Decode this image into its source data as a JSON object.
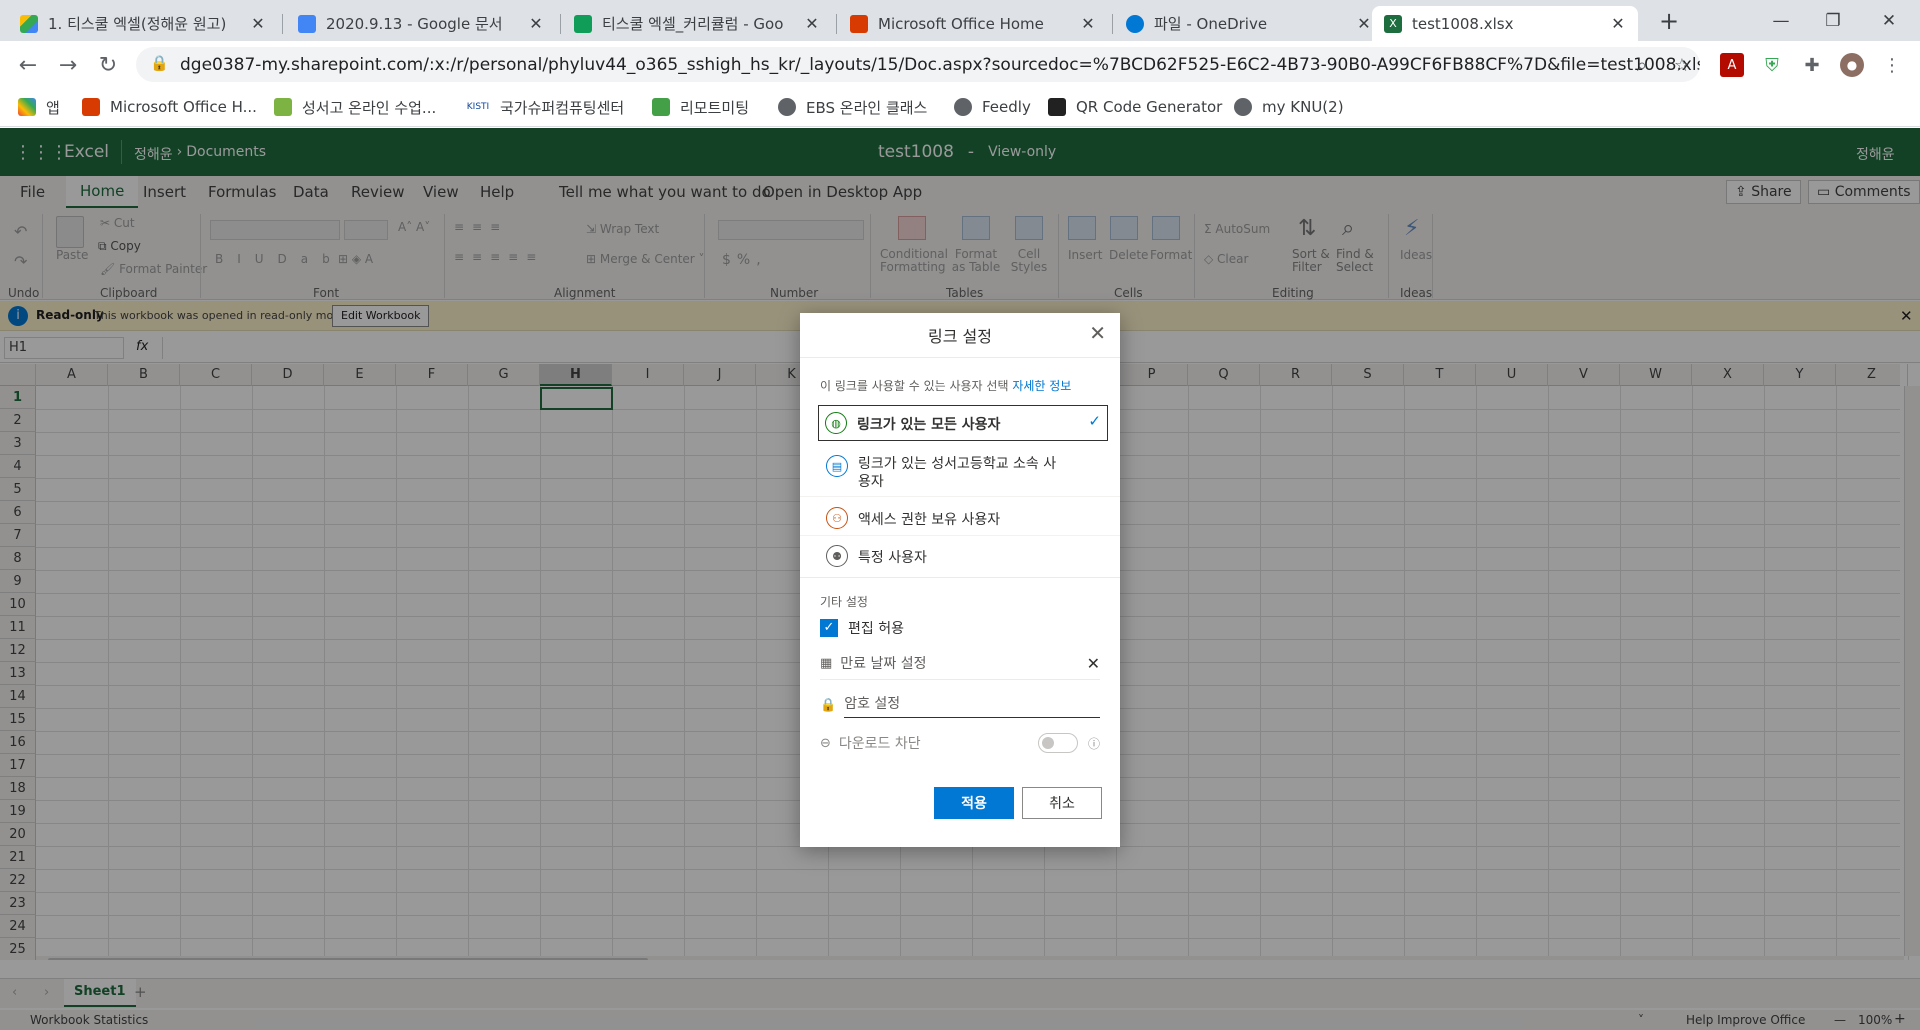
{
  "browser": {
    "tabs": [
      {
        "title": "1. 티스쿨 엑셀(정해윤 원고)",
        "icon": "google-drive-icon"
      },
      {
        "title": "2020.9.13 - Google 문서",
        "icon": "google-docs-icon"
      },
      {
        "title": "티스쿨 엑셀_커리큘럼 - Goo",
        "icon": "google-sheets-icon"
      },
      {
        "title": "Microsoft Office Home",
        "icon": "office-icon"
      },
      {
        "title": "파일 - OneDrive",
        "icon": "onedrive-icon"
      },
      {
        "title": "test1008.xlsx",
        "icon": "excel-icon"
      }
    ],
    "url": "dge0387-my.sharepoint.com/:x:/r/personal/phyluv44_o365_sshigh_hs_kr/_layouts/15/Doc.aspx?sourcedoc=%7BCD62F525-E6C2-4B73-90B0-A99CF6FB88CF%7D&file=test1008.xlsx&...",
    "bookmarks": [
      {
        "label": "앱"
      },
      {
        "label": "Microsoft Office H..."
      },
      {
        "label": "성서고 온라인 수업..."
      },
      {
        "label": "국가슈퍼컴퓨팅센터"
      },
      {
        "label": "리모트미팅"
      },
      {
        "label": "EBS 온라인 클래스"
      },
      {
        "label": "Feedly"
      },
      {
        "label": "QR Code Generator"
      },
      {
        "label": "my KNU(2)"
      }
    ]
  },
  "excel": {
    "app_name": "Excel",
    "breadcrumb_user": "정해윤",
    "breadcrumb_folder": "Documents",
    "file_name": "test1008",
    "separator": "-",
    "mode": "View-only",
    "user": "정해윤",
    "ribbon_tabs": [
      "File",
      "Home",
      "Insert",
      "Formulas",
      "Data",
      "Review",
      "View",
      "Help"
    ],
    "tell_me": "Tell me what you want to do",
    "open_desktop": "Open in Desktop App",
    "share": "Share",
    "comments": "Comments",
    "ribbon": {
      "undo": "Undo",
      "paste": "Paste",
      "cut": "Cut",
      "copy": "Copy",
      "format_painter": "Format Painter",
      "clipboard": "Clipboard",
      "font": "Font",
      "wrap_text": "Wrap Text",
      "merge_center": "Merge & Center",
      "alignment": "Alignment",
      "number": "Number",
      "conditional_formatting_1": "Conditional",
      "conditional_formatting_2": "Formatting",
      "format_as_table_1": "Format",
      "format_as_table_2": "as Table",
      "cell_styles_1": "Cell",
      "cell_styles_2": "Styles",
      "tables": "Tables",
      "insert": "Insert",
      "delete": "Delete",
      "format": "Format",
      "cells": "Cells",
      "autosum": "AutoSum",
      "clear": "Clear",
      "sort_filter_1": "Sort &",
      "sort_filter_2": "Filter",
      "find_select_1": "Find &",
      "find_select_2": "Select",
      "editing": "Editing",
      "ideas": "Ideas",
      "ideas_group": "Ideas"
    },
    "info_bar": {
      "label": "Read-only",
      "message": "This workbook was opened in read-only mode",
      "button": "Edit Workbook"
    },
    "name_box": "H1",
    "fx": "fx",
    "columns": [
      "A",
      "B",
      "C",
      "D",
      "E",
      "F",
      "G",
      "H",
      "I",
      "J",
      "K",
      "L",
      "M",
      "N",
      "O",
      "P",
      "Q",
      "R",
      "S",
      "T",
      "U",
      "V",
      "W",
      "X",
      "Y",
      "Z"
    ],
    "rows": [
      "1",
      "2",
      "3",
      "4",
      "5",
      "6",
      "7",
      "8",
      "9",
      "10",
      "11",
      "12",
      "13",
      "14",
      "15",
      "16",
      "17",
      "18",
      "19",
      "20",
      "21",
      "22",
      "23",
      "24",
      "25"
    ],
    "sheet_tab": "Sheet1",
    "add_sheet": "+",
    "status_left": "Workbook Statistics",
    "help_improve": "Help Improve Office",
    "zoom": "100%"
  },
  "dialog": {
    "title": "링크 설정",
    "prompt": "이 링크를 사용할 수 있는 사용자 선택",
    "learn_more": "자세한 정보",
    "options": [
      {
        "label": "링크가 있는 모든 사용자",
        "selected": true
      },
      {
        "label": "링크가 있는 성서고등학교 소속 사용자",
        "selected": false
      },
      {
        "label": "액세스 권한 보유 사용자",
        "selected": false
      },
      {
        "label": "특정 사용자",
        "selected": false
      }
    ],
    "other_settings": "기타 설정",
    "allow_edit": "편집 허용",
    "allow_edit_checked": true,
    "expiry": "만료 날짜 설정",
    "password": "암호 설정",
    "block_download": "다운로드 차단",
    "block_download_on": false,
    "apply": "적용",
    "cancel": "취소"
  },
  "colors": {
    "excel_green": "#1e6d3e",
    "accent_blue": "#0078d4"
  }
}
